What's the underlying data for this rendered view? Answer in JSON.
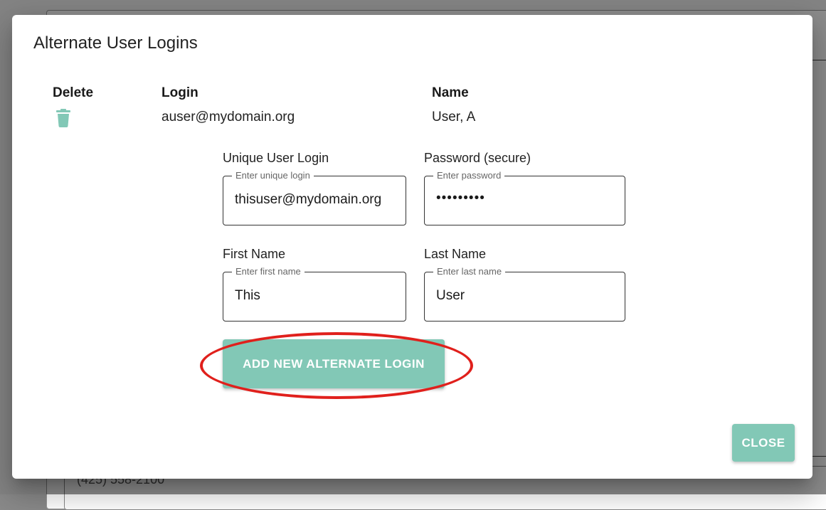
{
  "background": {
    "phone": "(425) 558-2100"
  },
  "dialog": {
    "title": "Alternate User Logins",
    "table": {
      "headers": {
        "delete": "Delete",
        "login": "Login",
        "name": "Name"
      },
      "rows": [
        {
          "login": "auser@mydomain.org",
          "name": "User, A",
          "delete_icon": "trash-icon"
        }
      ]
    },
    "form": {
      "unique_login": {
        "label": "Unique User Login",
        "legend": "Enter unique login",
        "value": "thisuser@mydomain.org"
      },
      "password": {
        "label": "Password (secure)",
        "legend": "Enter password",
        "value": "•••••••••"
      },
      "first_name": {
        "label": "First Name",
        "legend": "Enter first name",
        "value": "This"
      },
      "last_name": {
        "label": "Last Name",
        "legend": "Enter last name",
        "value": "User"
      }
    },
    "add_button_label": "ADD NEW ALTERNATE LOGIN",
    "close_button_label": "CLOSE"
  },
  "colors": {
    "accent": "#82c8b6",
    "highlight": "#e0201c"
  }
}
